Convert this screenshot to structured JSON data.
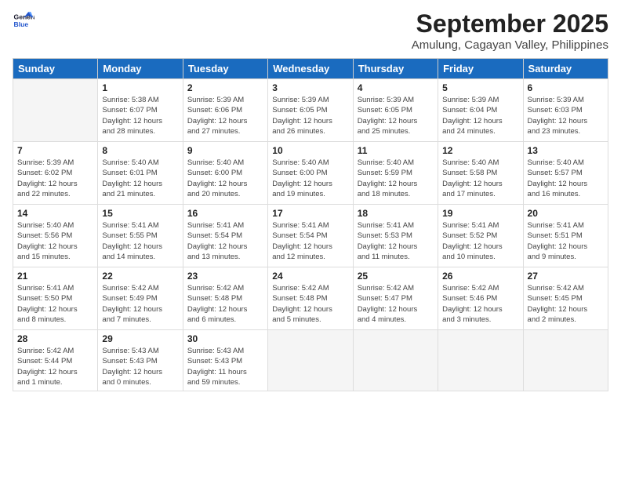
{
  "header": {
    "logo_line1": "General",
    "logo_line2": "Blue",
    "month": "September 2025",
    "location": "Amulung, Cagayan Valley, Philippines"
  },
  "days_of_week": [
    "Sunday",
    "Monday",
    "Tuesday",
    "Wednesday",
    "Thursday",
    "Friday",
    "Saturday"
  ],
  "weeks": [
    [
      {
        "day": "",
        "info": ""
      },
      {
        "day": "1",
        "info": "Sunrise: 5:38 AM\nSunset: 6:07 PM\nDaylight: 12 hours\nand 28 minutes."
      },
      {
        "day": "2",
        "info": "Sunrise: 5:39 AM\nSunset: 6:06 PM\nDaylight: 12 hours\nand 27 minutes."
      },
      {
        "day": "3",
        "info": "Sunrise: 5:39 AM\nSunset: 6:05 PM\nDaylight: 12 hours\nand 26 minutes."
      },
      {
        "day": "4",
        "info": "Sunrise: 5:39 AM\nSunset: 6:05 PM\nDaylight: 12 hours\nand 25 minutes."
      },
      {
        "day": "5",
        "info": "Sunrise: 5:39 AM\nSunset: 6:04 PM\nDaylight: 12 hours\nand 24 minutes."
      },
      {
        "day": "6",
        "info": "Sunrise: 5:39 AM\nSunset: 6:03 PM\nDaylight: 12 hours\nand 23 minutes."
      }
    ],
    [
      {
        "day": "7",
        "info": "Sunrise: 5:39 AM\nSunset: 6:02 PM\nDaylight: 12 hours\nand 22 minutes."
      },
      {
        "day": "8",
        "info": "Sunrise: 5:40 AM\nSunset: 6:01 PM\nDaylight: 12 hours\nand 21 minutes."
      },
      {
        "day": "9",
        "info": "Sunrise: 5:40 AM\nSunset: 6:00 PM\nDaylight: 12 hours\nand 20 minutes."
      },
      {
        "day": "10",
        "info": "Sunrise: 5:40 AM\nSunset: 6:00 PM\nDaylight: 12 hours\nand 19 minutes."
      },
      {
        "day": "11",
        "info": "Sunrise: 5:40 AM\nSunset: 5:59 PM\nDaylight: 12 hours\nand 18 minutes."
      },
      {
        "day": "12",
        "info": "Sunrise: 5:40 AM\nSunset: 5:58 PM\nDaylight: 12 hours\nand 17 minutes."
      },
      {
        "day": "13",
        "info": "Sunrise: 5:40 AM\nSunset: 5:57 PM\nDaylight: 12 hours\nand 16 minutes."
      }
    ],
    [
      {
        "day": "14",
        "info": "Sunrise: 5:40 AM\nSunset: 5:56 PM\nDaylight: 12 hours\nand 15 minutes."
      },
      {
        "day": "15",
        "info": "Sunrise: 5:41 AM\nSunset: 5:55 PM\nDaylight: 12 hours\nand 14 minutes."
      },
      {
        "day": "16",
        "info": "Sunrise: 5:41 AM\nSunset: 5:54 PM\nDaylight: 12 hours\nand 13 minutes."
      },
      {
        "day": "17",
        "info": "Sunrise: 5:41 AM\nSunset: 5:54 PM\nDaylight: 12 hours\nand 12 minutes."
      },
      {
        "day": "18",
        "info": "Sunrise: 5:41 AM\nSunset: 5:53 PM\nDaylight: 12 hours\nand 11 minutes."
      },
      {
        "day": "19",
        "info": "Sunrise: 5:41 AM\nSunset: 5:52 PM\nDaylight: 12 hours\nand 10 minutes."
      },
      {
        "day": "20",
        "info": "Sunrise: 5:41 AM\nSunset: 5:51 PM\nDaylight: 12 hours\nand 9 minutes."
      }
    ],
    [
      {
        "day": "21",
        "info": "Sunrise: 5:41 AM\nSunset: 5:50 PM\nDaylight: 12 hours\nand 8 minutes."
      },
      {
        "day": "22",
        "info": "Sunrise: 5:42 AM\nSunset: 5:49 PM\nDaylight: 12 hours\nand 7 minutes."
      },
      {
        "day": "23",
        "info": "Sunrise: 5:42 AM\nSunset: 5:48 PM\nDaylight: 12 hours\nand 6 minutes."
      },
      {
        "day": "24",
        "info": "Sunrise: 5:42 AM\nSunset: 5:48 PM\nDaylight: 12 hours\nand 5 minutes."
      },
      {
        "day": "25",
        "info": "Sunrise: 5:42 AM\nSunset: 5:47 PM\nDaylight: 12 hours\nand 4 minutes."
      },
      {
        "day": "26",
        "info": "Sunrise: 5:42 AM\nSunset: 5:46 PM\nDaylight: 12 hours\nand 3 minutes."
      },
      {
        "day": "27",
        "info": "Sunrise: 5:42 AM\nSunset: 5:45 PM\nDaylight: 12 hours\nand 2 minutes."
      }
    ],
    [
      {
        "day": "28",
        "info": "Sunrise: 5:42 AM\nSunset: 5:44 PM\nDaylight: 12 hours\nand 1 minute."
      },
      {
        "day": "29",
        "info": "Sunrise: 5:43 AM\nSunset: 5:43 PM\nDaylight: 12 hours\nand 0 minutes."
      },
      {
        "day": "30",
        "info": "Sunrise: 5:43 AM\nSunset: 5:43 PM\nDaylight: 11 hours\nand 59 minutes."
      },
      {
        "day": "",
        "info": ""
      },
      {
        "day": "",
        "info": ""
      },
      {
        "day": "",
        "info": ""
      },
      {
        "day": "",
        "info": ""
      }
    ]
  ]
}
